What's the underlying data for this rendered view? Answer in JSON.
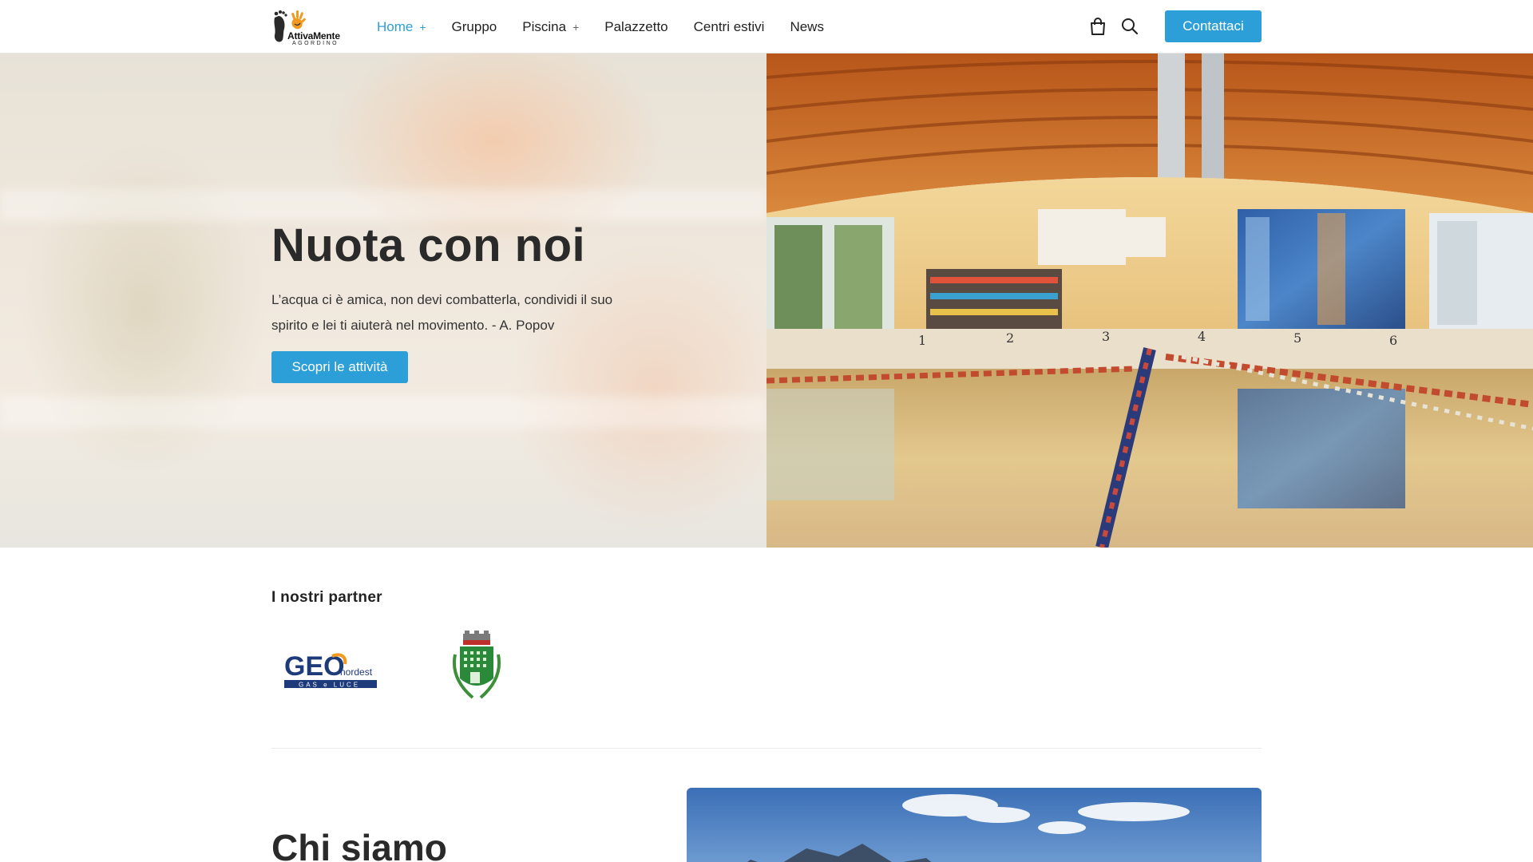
{
  "header": {
    "logo": {
      "name": "AttivaMente",
      "sub": "AGORDINO"
    },
    "nav": [
      {
        "label": "Home",
        "has_submenu": true,
        "active": true
      },
      {
        "label": "Gruppo",
        "has_submenu": false,
        "active": false
      },
      {
        "label": "Piscina",
        "has_submenu": true,
        "active": false
      },
      {
        "label": "Palazzetto",
        "has_submenu": false,
        "active": false
      },
      {
        "label": "Centri estivi",
        "has_submenu": false,
        "active": false
      },
      {
        "label": "News",
        "has_submenu": false,
        "active": false
      }
    ],
    "cart_icon": "shopping-bag-icon",
    "search_icon": "search-icon",
    "cta_label": "Contattaci"
  },
  "hero": {
    "title": "Nuota con noi",
    "quote": "L’acqua ci è amica, non devi combatterla, condividi il suo spirito e lei ti aiuterà nel movimento. - A. Popov",
    "button_label": "Scopri le attività"
  },
  "partners": {
    "title": "I nostri partner",
    "logo_geo": {
      "main": "GEO",
      "sub": "nordest",
      "tagline": "GAS e LUCE"
    }
  },
  "about": {
    "title": "Chi siamo"
  },
  "colors": {
    "accent": "#2d9fd8",
    "text": "#222222"
  }
}
